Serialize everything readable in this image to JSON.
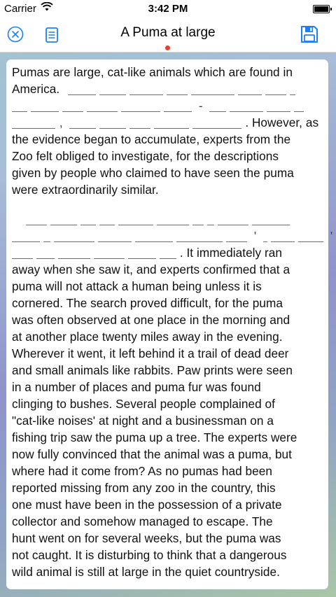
{
  "status_bar": {
    "carrier": "Carrier",
    "time": "3:42 PM"
  },
  "nav": {
    "title": "A Puma at large"
  },
  "colors": {
    "blank_underline": "#e33a2a",
    "page_dot": "#e3402d",
    "icon_blue": "#1a7ff5"
  },
  "icons": {
    "left": "close-circle-icon",
    "second": "list-document-icon",
    "right": "floppy-disk-save-icon"
  },
  "passage": {
    "p1_line1": "Pumas are large, cat-like animals which are found in",
    "p1_line2_start": "America.",
    "p1_line4_end": ". However, as",
    "p1_line4_comma": ",",
    "p1_line3_hyphen": "-",
    "p1_rest": [
      "the evidence began to accumulate, experts from the",
      "Zoo felt obliged to investigate, for the descriptions",
      "given by people who claimed to have seen the puma",
      "were extraordinarily similar."
    ],
    "p2_line3_end": ". It immediately ran",
    "p2_line2_mark1": "'",
    "p2_line2_mark2": "'",
    "p2_rest": [
      "away when she saw it, and experts confirmed that a",
      "puma will not attack a human being unless it is",
      "cornered. The search proved difficult, for the puma",
      "was often observed at one place in the morning and",
      "at another place twenty miles away in the evening.",
      "Wherever it went, it left behind it a trail of dead deer",
      "and small animals like rabbits. Paw prints were seen",
      "in a number of places and puma fur was found",
      "clinging to bushes. Several people complained of",
      "\"cat-like noises' at night and a businessman on a",
      "fishing trip saw the puma up a tree. The experts were",
      "now fully convinced that the animal was a puma, but",
      "where had it come from? As no pumas had been",
      "reported missing from any zoo in the country, this",
      "one must have been in the possession of a private",
      "collector and somehow managed to escape. The",
      "hunt went on for several weeks, but the puma was",
      "not caught. It is disturbing to think that a dangerous",
      "wild animal is still at large in the quiet countryside."
    ]
  }
}
